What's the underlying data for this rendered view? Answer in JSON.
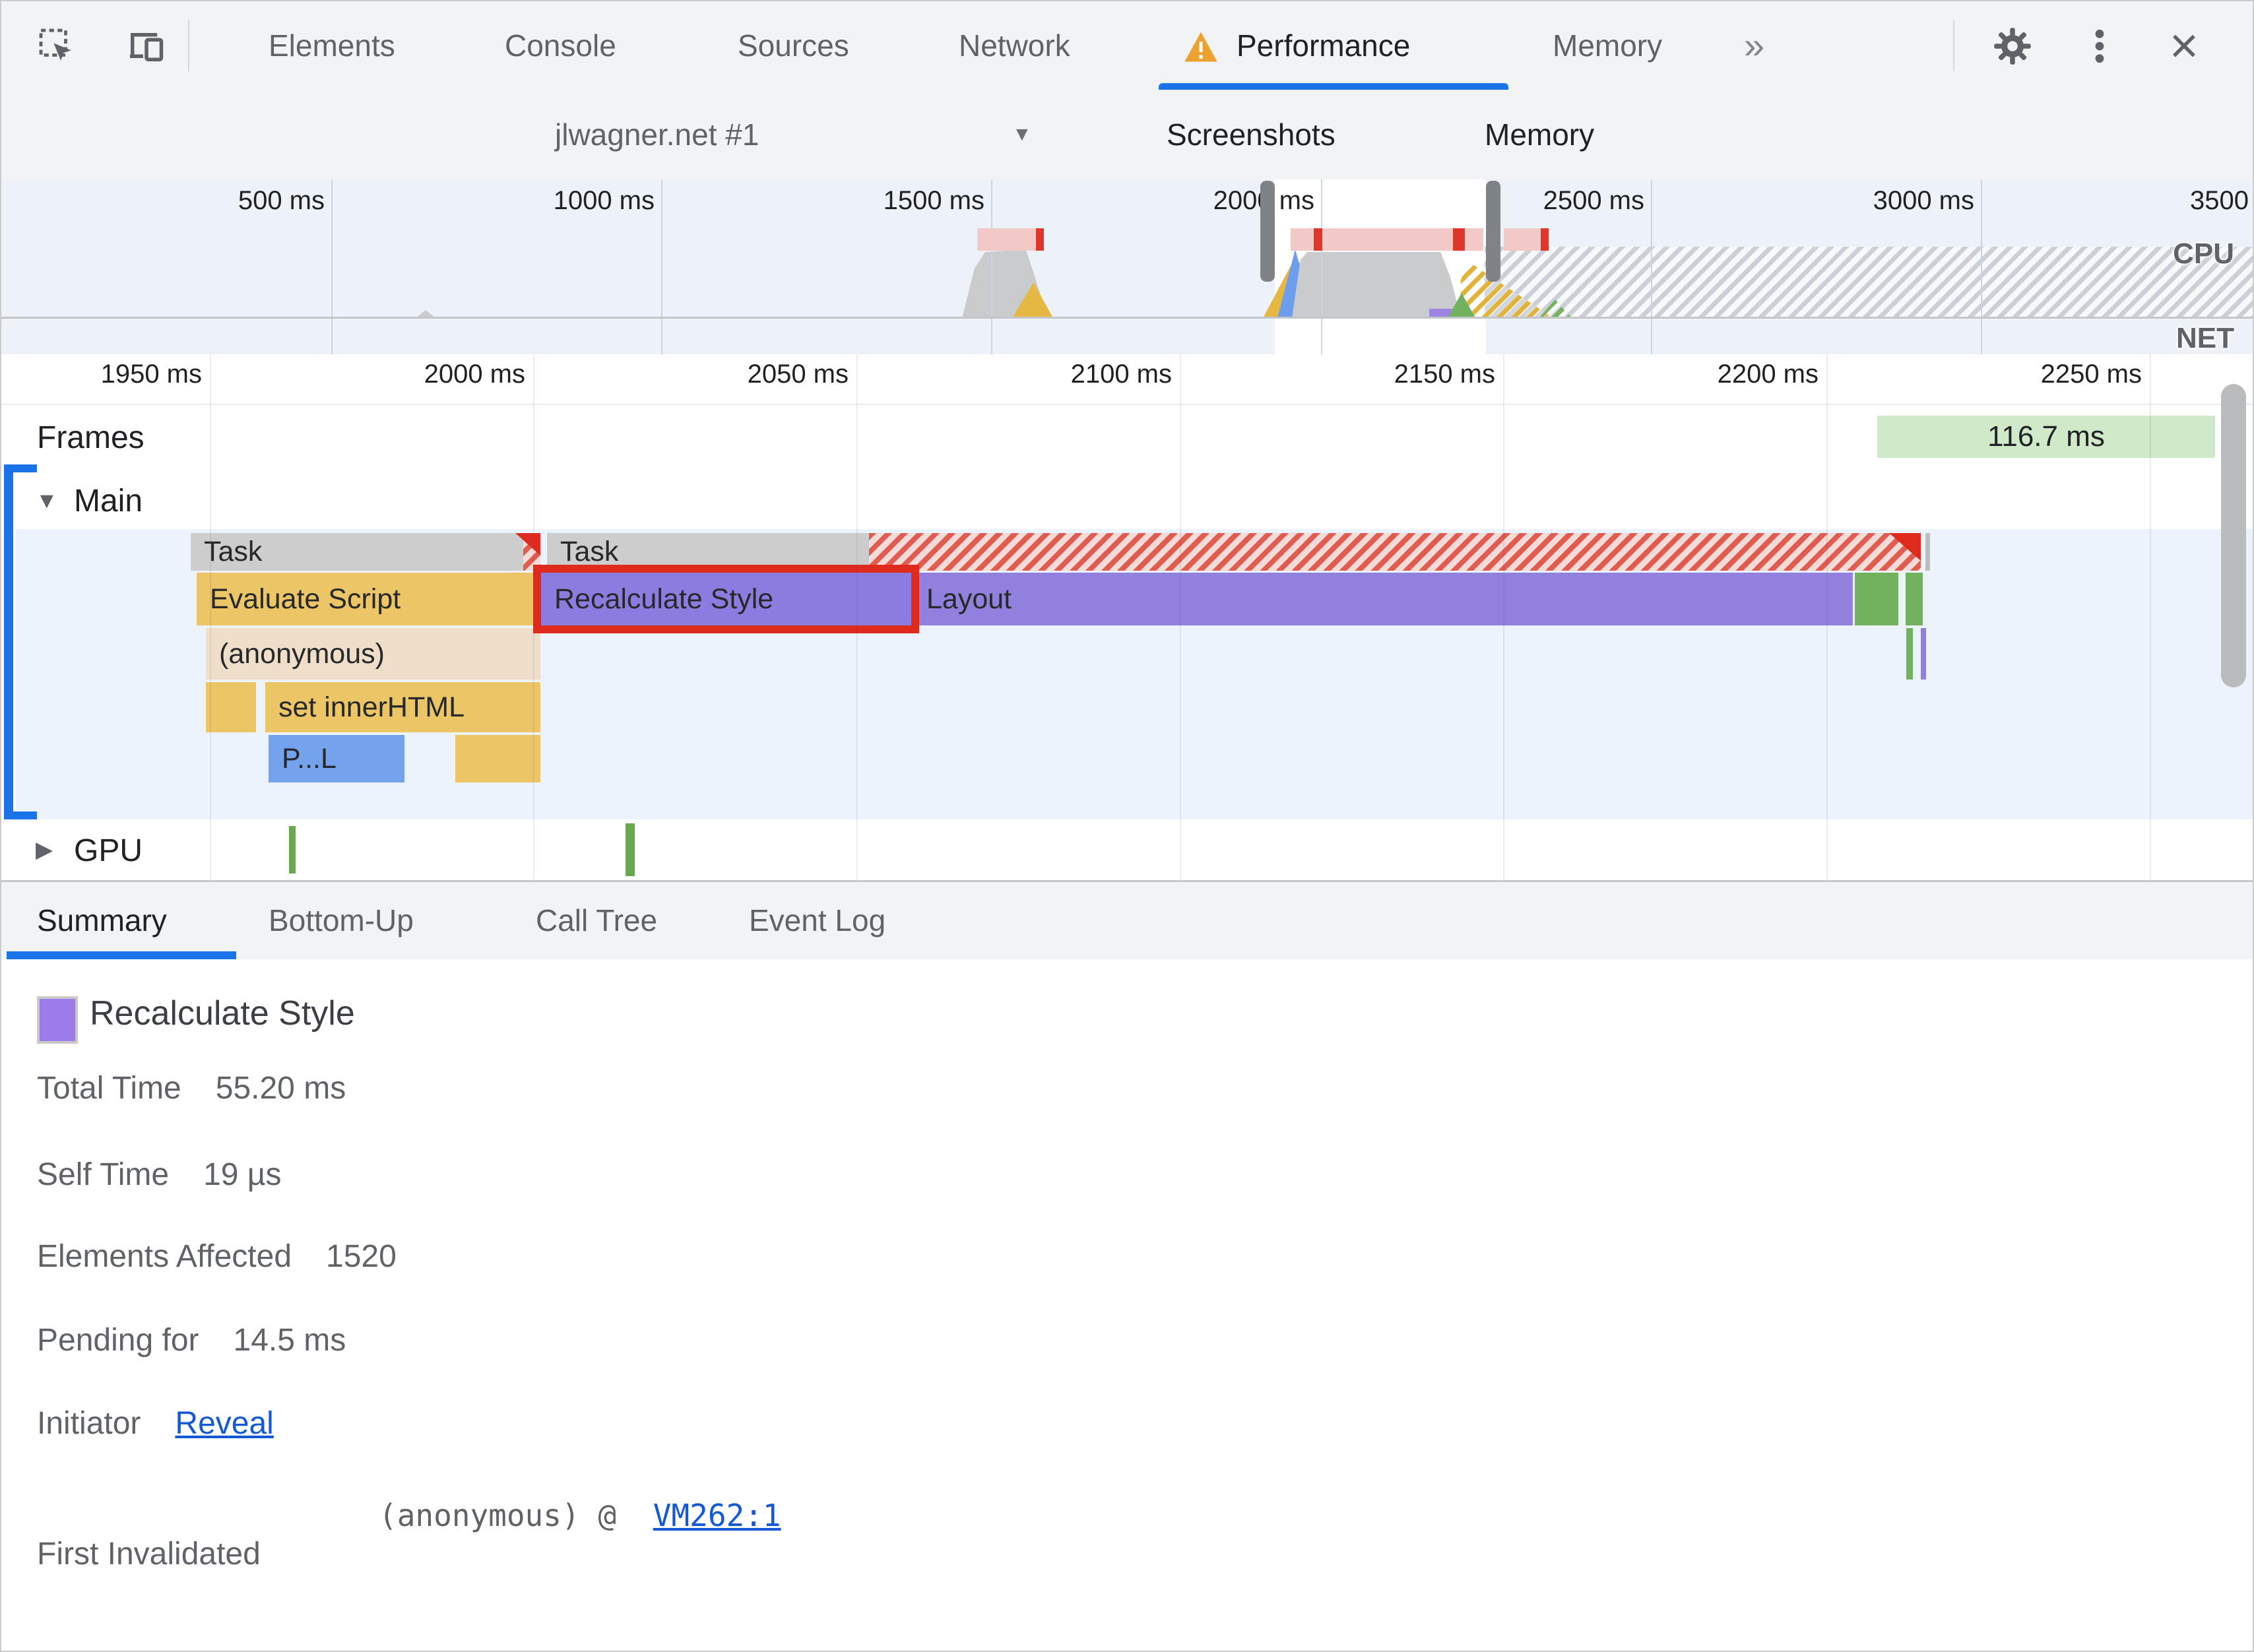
{
  "tabs": {
    "items": [
      "Elements",
      "Console",
      "Sources",
      "Network",
      "Performance",
      "Memory"
    ],
    "active": "Performance",
    "overflow_chevron": "»"
  },
  "toolbar": {
    "profile_name": "jlwagner.net #1",
    "screenshots_label": "Screenshots",
    "memory_label": "Memory"
  },
  "overview": {
    "ruler": [
      "500 ms",
      "1000 ms",
      "1500 ms",
      "2000 ms",
      "2500 ms",
      "3000 ms",
      "3500"
    ],
    "cpu_label": "CPU",
    "net_label": "NET"
  },
  "timeline": {
    "ruler": [
      "1950 ms",
      "2000 ms",
      "2050 ms",
      "2100 ms",
      "2150 ms",
      "2200 ms",
      "2250 ms"
    ],
    "frames_label": "Frames",
    "frame_duration_badge": "116.7 ms",
    "main_label": "Main",
    "gpu_label": "GPU",
    "bars": {
      "task1": "Task",
      "task2": "Task",
      "evaluate_script": "Evaluate Script",
      "recalculate_style": "Recalculate Style",
      "layout": "Layout",
      "anonymous": "(anonymous)",
      "set_inner_html": "set innerHTML",
      "parse_html": "P...L"
    }
  },
  "bottom_tabs": {
    "items": [
      "Summary",
      "Bottom-Up",
      "Call Tree",
      "Event Log"
    ],
    "active": "Summary"
  },
  "summary": {
    "title": "Recalculate Style",
    "rows": [
      {
        "label": "Total Time",
        "value": "55.20 ms"
      },
      {
        "label": "Self Time",
        "value": "19 µs"
      },
      {
        "label": "Elements Affected",
        "value": "1520"
      },
      {
        "label": "Pending for",
        "value": "14.5 ms"
      }
    ],
    "initiator_label": "Initiator",
    "initiator_link": "Reveal",
    "first_invalidated_label": "First Invalidated",
    "stack_frame": "(anonymous) @",
    "stack_link": "VM262:1"
  },
  "colors": {
    "accent_blue": "#1a73e8",
    "purple_event": "#9180dd",
    "scripting_yellow": "#ecc566",
    "painting_green": "#72b25f",
    "loading_blue": "#74a2ec",
    "js_frame_tan": "#efdfca",
    "task_gray": "#cecdce",
    "highlight_red": "#df2b1e",
    "frame_badge_green": "#cfe9c9",
    "link_blue": "#1558d6",
    "warning_orange": "#eda12f"
  }
}
